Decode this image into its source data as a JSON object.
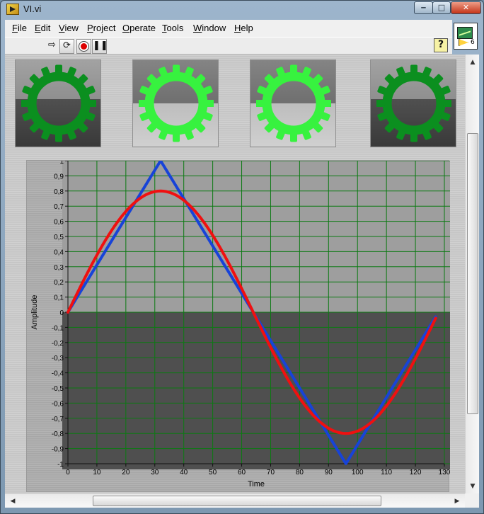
{
  "window": {
    "title": "VI.vi",
    "min": "‒",
    "max": "□",
    "close": "✕"
  },
  "menu": {
    "items": [
      {
        "label": "File",
        "u": "F",
        "rest": "ile"
      },
      {
        "label": "Edit",
        "u": "E",
        "rest": "dit"
      },
      {
        "label": "View",
        "u": "V",
        "rest": "iew"
      },
      {
        "label": "Project",
        "u": "P",
        "rest": "roject"
      },
      {
        "label": "Operate",
        "u": "O",
        "rest": "perate"
      },
      {
        "label": "Tools",
        "u": "T",
        "rest": "ools"
      },
      {
        "label": "Window",
        "u": "W",
        "rest": "indow"
      },
      {
        "label": "Help",
        "u": "H",
        "rest": "elp"
      }
    ]
  },
  "toolbar": {
    "run": "⇨",
    "continuous": "⟳",
    "pause": "❚❚",
    "help": "?"
  },
  "vi_icon": {
    "number": "6"
  },
  "indicators": [
    {
      "state": "off"
    },
    {
      "state": "on"
    },
    {
      "state": "on"
    },
    {
      "state": "off"
    }
  ],
  "colors": {
    "gear_on": "#37f23f",
    "gear_off": "#0b8f1f",
    "triangle": "#1743d8",
    "sine": "#f01010",
    "grid": "#0b7a12"
  },
  "chart_data": {
    "type": "line",
    "xlabel": "Time",
    "ylabel": "Amplitude",
    "xlim": [
      0,
      130
    ],
    "ylim": [
      -1,
      1
    ],
    "x_ticks": [
      "0",
      "10",
      "20",
      "30",
      "40",
      "50",
      "60",
      "70",
      "80",
      "90",
      "100",
      "110",
      "120",
      "130"
    ],
    "y_ticks": [
      "1",
      "0,9",
      "0,8",
      "0,7",
      "0,6",
      "0,5",
      "0,4",
      "0,3",
      "0,2",
      "0,1",
      "0",
      "-0,1",
      "-0,2",
      "-0,3",
      "-0,4",
      "-0,5",
      "-0,6",
      "-0,7",
      "-0,8",
      "-0,9",
      "-1"
    ],
    "grid": true,
    "series": [
      {
        "color": "#1743d8",
        "kind": "triangle",
        "x": [
          0,
          32,
          96,
          127
        ],
        "y": [
          0,
          1,
          -1,
          -0.03
        ]
      },
      {
        "color": "#f01010",
        "kind": "sine",
        "x": [
          0,
          8,
          16,
          24,
          32,
          40,
          48,
          56,
          64,
          72,
          80,
          88,
          96,
          104,
          112,
          120,
          127
        ],
        "y": [
          0,
          0.31,
          0.57,
          0.74,
          0.8,
          0.74,
          0.57,
          0.31,
          0,
          -0.31,
          -0.57,
          -0.74,
          -0.8,
          -0.74,
          -0.57,
          -0.31,
          -0.03
        ]
      }
    ]
  }
}
